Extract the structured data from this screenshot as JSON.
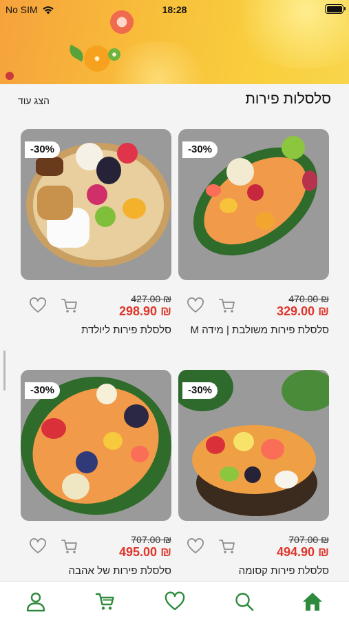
{
  "status_bar": {
    "carrier": "No SIM",
    "time": "18:28"
  },
  "section": {
    "title": "סלסלות פירות",
    "show_more": "הצג עוד"
  },
  "products": [
    {
      "name": "סלסלת פירות משולבת | מידה M",
      "price": "₪ 329.00",
      "old_price": "₪ 470.00",
      "discount": "-30%"
    },
    {
      "name": "סלסלת פירות ליולדת",
      "price": "₪ 298.90",
      "old_price": "₪ 427.00",
      "discount": "-30%"
    },
    {
      "name": "סלסלת פירות קסומה",
      "price": "₪ 494.90",
      "old_price": "₪ 707.00",
      "discount": "-30%"
    },
    {
      "name": "סלסלת פירות של אהבה",
      "price": "₪ 495.00",
      "old_price": "₪ 707.00",
      "discount": "-30%"
    }
  ],
  "nav": [
    "home-icon",
    "search-icon",
    "heart-icon",
    "cart-icon",
    "user-icon"
  ],
  "colors": {
    "brand_green": "#2e8a3c",
    "sale_red": "#e0352b"
  }
}
